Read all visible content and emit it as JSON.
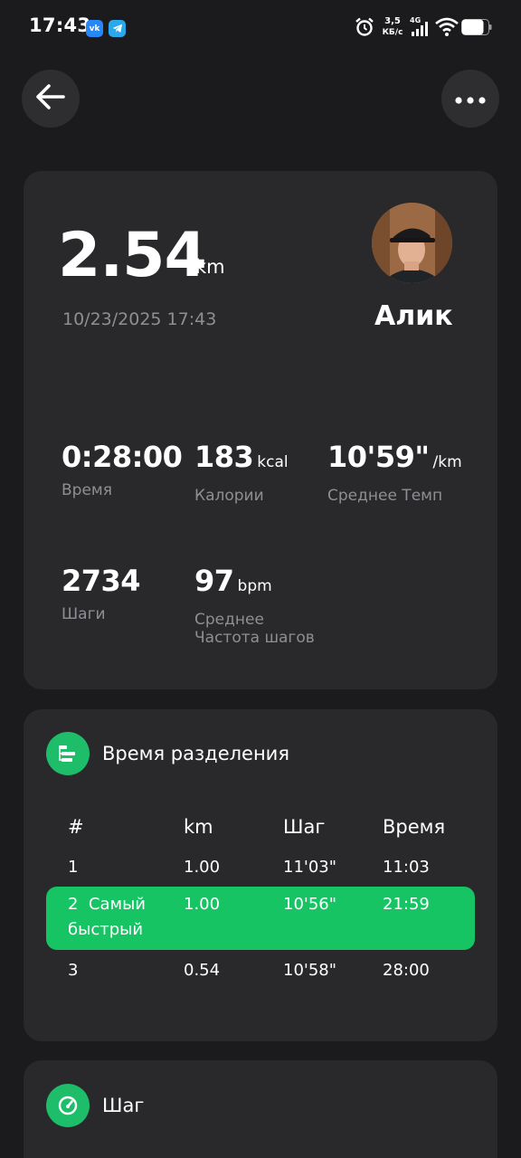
{
  "status_bar": {
    "time": "17:43",
    "notification_icons": [
      "vk-icon",
      "telegram-icon"
    ],
    "speed_value": "3,5",
    "speed_unit": "КБ/с",
    "network": "4G",
    "system_icons": [
      "alarm-icon",
      "signal-icon",
      "wifi-icon",
      "battery-icon"
    ]
  },
  "header": {
    "back_icon": "arrow-left-icon",
    "more_icon": "more-horizontal-icon"
  },
  "summary": {
    "distance": "2.54",
    "distance_unit": "km",
    "datetime": "10/23/2025 17:43",
    "user_name": "Алик",
    "stats": [
      {
        "value": "0:28:00",
        "unit": "",
        "label": "Время"
      },
      {
        "value": "183",
        "unit": "kcal",
        "label": "Калории"
      },
      {
        "value": "10'59\"",
        "unit": "/km",
        "label": "Среднее Темп"
      },
      {
        "value": "2734",
        "unit": "",
        "label": "Шаги"
      },
      {
        "value": "97",
        "unit": "bpm",
        "label_line1": "Среднее",
        "label_line2": "Частота шагов"
      }
    ]
  },
  "splits": {
    "title": "Время разделения",
    "icon": "splits-list-icon",
    "columns": [
      "#",
      "km",
      "Шаг",
      "Время"
    ],
    "rows": [
      {
        "index": "1",
        "km": "1.00",
        "pace": "11'03\"",
        "time": "11:03"
      },
      {
        "index_line1": "2  Самый",
        "index_line2": "быстрый",
        "km": "1.00",
        "pace": "10'56\"",
        "time": "21:59",
        "highlight": true
      },
      {
        "index": "3",
        "km": "0.54",
        "pace": "10'58\"",
        "time": "28:00"
      }
    ],
    "highlight_color": "#16c464"
  },
  "step_section": {
    "title": "Шаг",
    "icon": "speedometer-icon"
  },
  "colors": {
    "background": "#1b1b1d",
    "card": "#29292c",
    "accent": "#1dbd6a",
    "muted_text": "#8f8f93"
  }
}
